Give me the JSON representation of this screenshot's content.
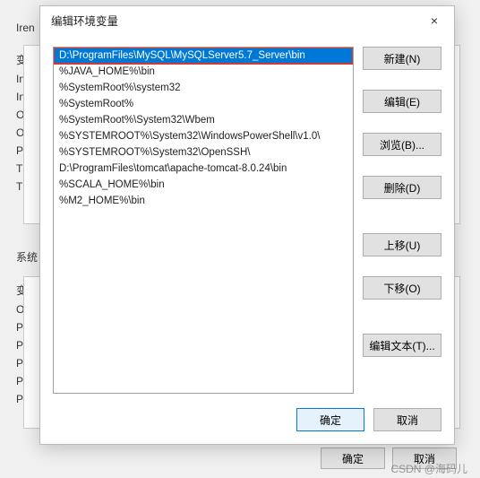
{
  "bg": {
    "label1": "Iren",
    "section2": "系统",
    "partials1": [
      "变",
      "In",
      "In",
      "O",
      "O",
      "P",
      "TE",
      "TI"
    ],
    "partials2": [
      "变",
      "O",
      "P",
      "P",
      "PI",
      "PI",
      "PI"
    ],
    "ok": "确定",
    "cancel": "取消"
  },
  "dialog": {
    "title": "编辑环境变量",
    "close": "×",
    "items": [
      "D:\\ProgramFiles\\MySQL\\MySQLServer5.7_Server\\bin",
      "%JAVA_HOME%\\bin",
      "%SystemRoot%\\system32",
      "%SystemRoot%",
      "%SystemRoot%\\System32\\Wbem",
      "%SYSTEMROOT%\\System32\\WindowsPowerShell\\v1.0\\",
      "%SYSTEMROOT%\\System32\\OpenSSH\\",
      "D:\\ProgramFiles\\tomcat\\apache-tomcat-8.0.24\\bin",
      "%SCALA_HOME%\\bin",
      "%M2_HOME%\\bin"
    ],
    "buttons": {
      "new": "新建(N)",
      "edit": "编辑(E)",
      "browse": "浏览(B)...",
      "delete": "删除(D)",
      "up": "上移(U)",
      "down": "下移(O)",
      "editText": "编辑文本(T)...",
      "ok": "确定",
      "cancel": "取消"
    }
  },
  "watermark": "CSDN @海码儿"
}
